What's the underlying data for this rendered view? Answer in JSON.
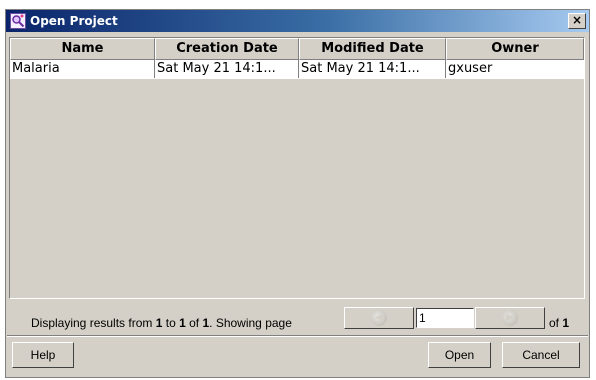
{
  "window": {
    "title": "Open Project",
    "icon": "open-project-icon",
    "close_label": "×"
  },
  "table": {
    "columns": [
      "Name",
      "Creation Date",
      "Modified Date",
      "Owner"
    ],
    "rows": [
      [
        "Malaria",
        "Sat May 21 14:1...",
        "Sat May 21 14:1...",
        "gxuser"
      ]
    ]
  },
  "pager": {
    "prefix": "Displaying results from ",
    "from": "1",
    "to_word": " to ",
    "to": "1",
    "of_word": " of ",
    "total": "1",
    "suffix": ". Showing page",
    "page_value": "1",
    "of_pages_word": "of ",
    "total_pages": "1",
    "prev_icon": "previous-page-icon",
    "next_icon": "next-page-icon"
  },
  "buttons": {
    "help": "Help",
    "open": "Open",
    "cancel": "Cancel"
  }
}
